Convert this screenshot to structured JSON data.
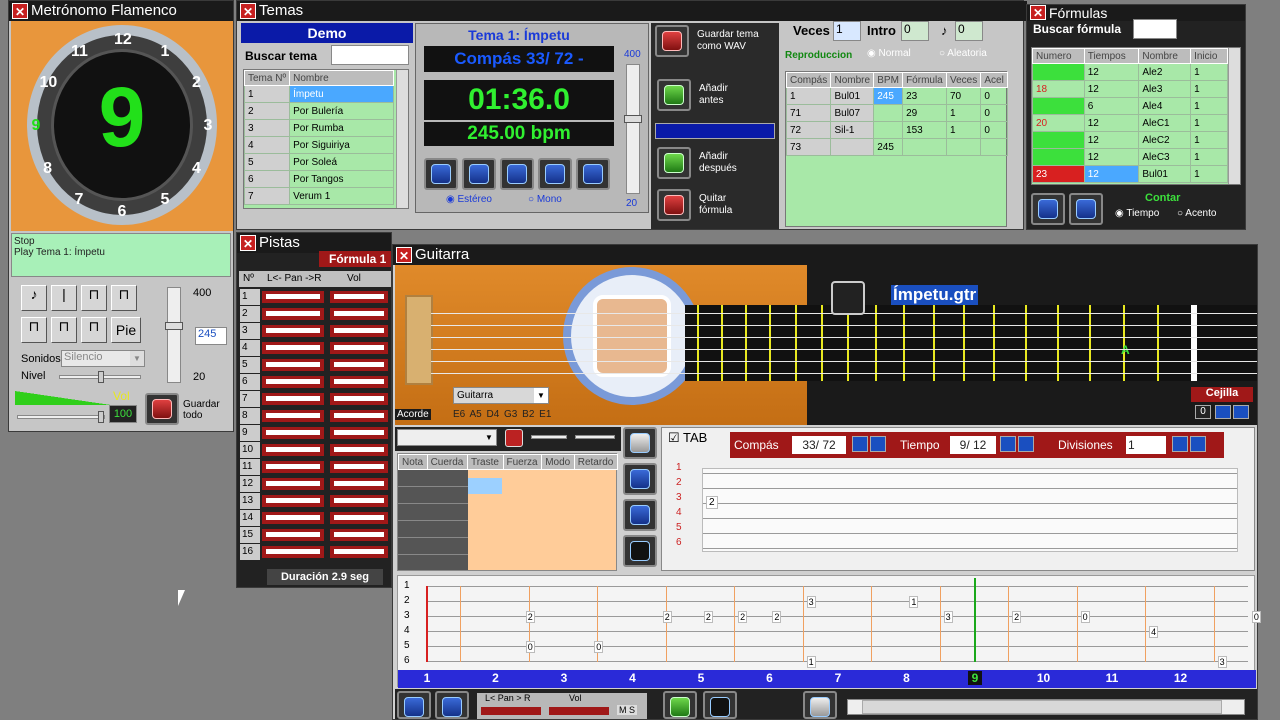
{
  "metronome": {
    "title": "Metrónomo Flamenco",
    "beat": "9",
    "dial": [
      "12",
      "1",
      "2",
      "3",
      "4",
      "5",
      "6",
      "7",
      "8",
      "9",
      "10",
      "11"
    ],
    "log": [
      "Stop",
      "Play Tema 1: Ímpetu"
    ],
    "bpm_max": "400",
    "bpm_value": "245",
    "bpm_min": "20",
    "sounds_label": "Sonidos",
    "sounds_value": "Silencio",
    "level_label": "Nivel",
    "vol_label": "Vol",
    "vol_value": "100",
    "save_all": [
      "Guardar",
      "todo"
    ],
    "pie": "Pie"
  },
  "temas": {
    "title": "Temas",
    "group": "Demo",
    "search_label": "Buscar tema",
    "headers": [
      "Tema Nº",
      "Nombre"
    ],
    "rows": [
      [
        "1",
        "Ímpetu"
      ],
      [
        "2",
        "Por Bulería"
      ],
      [
        "3",
        "Por Rumba"
      ],
      [
        "4",
        "Por Siguiriya"
      ],
      [
        "5",
        "Por Soleá"
      ],
      [
        "6",
        "Por Tangos"
      ],
      [
        "7",
        "Verum 1"
      ]
    ],
    "tema_label": "Tema 1: Ímpetu",
    "compas_label": "Compás  33/ 72 -",
    "time": "01:36.0",
    "bpm": "245.00 bpm",
    "slider_max": "400",
    "slider_min": "20",
    "stereo": "Estéreo",
    "mono": "Mono",
    "save_wav": [
      "Guardar tema",
      "como WAV"
    ],
    "add_before": [
      "Añadir",
      "antes"
    ],
    "add_after": [
      "Añadir",
      "después"
    ],
    "remove_formula": [
      "Quitar",
      "fórmula"
    ],
    "veces_label": "Veces",
    "veces_value": "1",
    "intro_label": "Intro",
    "intro_value": "0",
    "flag_value": "0",
    "repro_label": "Reproduccion",
    "normal": "Normal",
    "random": "Aleatoria",
    "seq_headers": [
      "Compás",
      "Nombre",
      "BPM",
      "Fórmula",
      "Veces",
      "Acel"
    ],
    "seq_rows": [
      [
        "1",
        "Bul01",
        "245",
        "23",
        "70",
        "0"
      ],
      [
        "71",
        "Bul07",
        "",
        "29",
        "1",
        "0"
      ],
      [
        "72",
        "Sil-1",
        "",
        "153",
        "1",
        "0"
      ],
      [
        "73",
        "",
        "245",
        "",
        "",
        ""
      ]
    ]
  },
  "formulas": {
    "title": "Fórmulas",
    "search_label": "Buscar fórmula",
    "headers": [
      "Numero",
      "Tiempos",
      "Nombre",
      "Inicio"
    ],
    "rows": [
      [
        "",
        "12",
        "Ale2",
        "1"
      ],
      [
        "18",
        "12",
        "Ale3",
        "1"
      ],
      [
        "",
        "6",
        "Ale4",
        "1"
      ],
      [
        "20",
        "12",
        "AleC1",
        "1"
      ],
      [
        "",
        "12",
        "AleC2",
        "1"
      ],
      [
        "",
        "12",
        "AleC3",
        "1"
      ],
      [
        "23",
        "12",
        "Bul01",
        "1"
      ]
    ],
    "count_label": "Contar",
    "time_opt": "Tiempo",
    "accent_opt": "Acento"
  },
  "pistas": {
    "title": "Pistas",
    "formula_tab": "Fórmula 1",
    "headers": [
      "Nº",
      "L<- Pan ->R",
      "Vol"
    ],
    "tracks": [
      "1",
      "2",
      "3",
      "4",
      "5",
      "6",
      "7",
      "8",
      "9",
      "10",
      "11",
      "12",
      "13",
      "14",
      "15",
      "16"
    ],
    "duration": "Duración  2.9 seg"
  },
  "guitarra": {
    "title": "Guitarra",
    "file": "Ímpetu.gtr",
    "instrument": "Guitarra",
    "acorde": "Acorde",
    "strings": "E6  A5  D4  G3  B2  E1",
    "cejilla": "Cejilla",
    "cejilla_value": "0",
    "chord_mark": "A",
    "tab_check": "TAB",
    "compas_label": "Compás",
    "compas_value": "33/ 72",
    "tiempo_label": "Tiempo",
    "tiempo_value": "9/ 12",
    "div_label": "Divisiones",
    "div_value": "1",
    "note_headers": [
      "Nota",
      "Cuerda",
      "Traste",
      "Fuerza",
      "Modo",
      "Retardo"
    ],
    "edit_lines": [
      "1",
      "2",
      "3",
      "4",
      "5",
      "6"
    ],
    "edit_note": "2",
    "tab_lines": [
      "1",
      "2",
      "3",
      "4",
      "5",
      "6"
    ],
    "beats": [
      "1",
      "2",
      "3",
      "4",
      "5",
      "6",
      "7",
      "8",
      "9",
      "10",
      "11",
      "12"
    ],
    "pan_label": "L< Pan > R",
    "vol_label": "Vol",
    "ms": "M S",
    "tab_notes": [
      {
        "x": "2",
        "s": "3",
        "v": "2"
      },
      {
        "x": "2",
        "s": "5",
        "v": "0"
      },
      {
        "x": "3",
        "s": "5",
        "v": "0"
      },
      {
        "x": "4",
        "s": "3",
        "v": "2"
      },
      {
        "x": "4.6",
        "s": "3",
        "v": "2"
      },
      {
        "x": "5.1",
        "s": "3",
        "v": "2"
      },
      {
        "x": "5.6",
        "s": "3",
        "v": "2"
      },
      {
        "x": "6.1",
        "s": "2",
        "v": "3"
      },
      {
        "x": "6.1",
        "s": "6",
        "v": "1"
      },
      {
        "x": "7.6",
        "s": "2",
        "v": "1"
      },
      {
        "x": "8.1",
        "s": "3",
        "v": "3"
      },
      {
        "x": "9.1",
        "s": "3",
        "v": "2"
      },
      {
        "x": "10.1",
        "s": "3",
        "v": "0"
      },
      {
        "x": "11.1",
        "s": "4",
        "v": "4"
      },
      {
        "x": "12.1",
        "s": "6",
        "v": "3"
      },
      {
        "x": "12.6",
        "s": "3",
        "v": "0"
      }
    ]
  }
}
